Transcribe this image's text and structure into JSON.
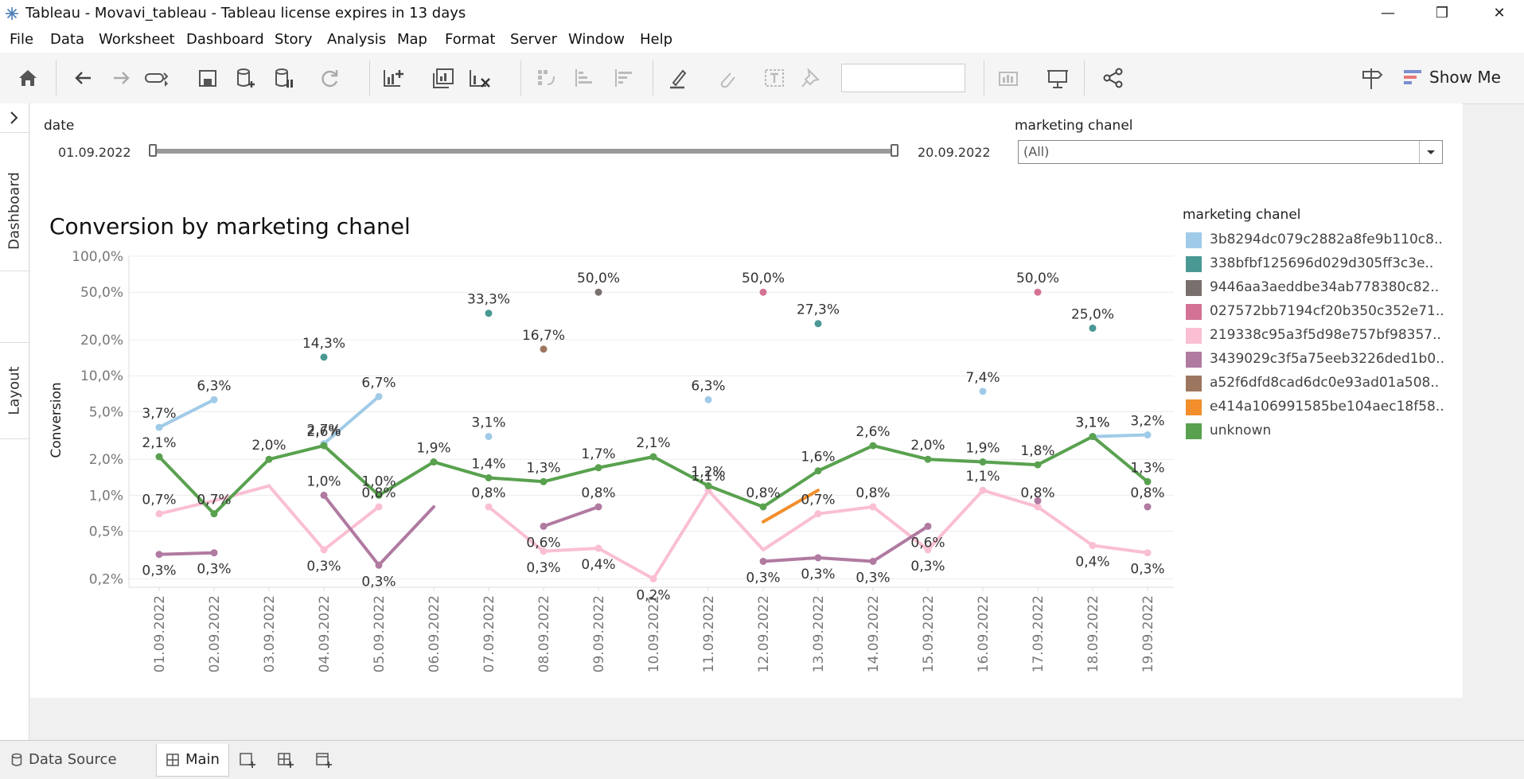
{
  "window": {
    "title": "Tableau - Movavi_tableau - Tableau license expires in 13 days",
    "controls": [
      "—",
      "❒",
      "✕"
    ]
  },
  "menu": [
    "File",
    "Data",
    "Worksheet",
    "Dashboard",
    "Story",
    "Analysis",
    "Map",
    "Format",
    "Server",
    "Window",
    "Help"
  ],
  "toolbar": {
    "show_me_label": "Show Me",
    "icons": [
      "home-icon",
      "back-icon",
      "forward-icon",
      "cycle-icon",
      "save-icon",
      "new-datasource-icon",
      "pause-icon",
      "refresh-icon",
      "new-worksheet-icon",
      "duplicate-icon",
      "clear-icon",
      "swap-icon",
      "sort-asc-icon",
      "sort-desc-icon",
      "highlight-icon",
      "attach-icon",
      "text-icon",
      "pin-icon",
      "fit-icon",
      "presentation-icon",
      "share-icon",
      "signpost-icon"
    ]
  },
  "sidebar": {
    "tabs": [
      "Dashboard",
      "Layout"
    ]
  },
  "filters": {
    "date": {
      "label": "date",
      "start": "01.09.2022",
      "end": "20.09.2022"
    },
    "channel": {
      "label": "marketing chanel",
      "value": "(All)"
    }
  },
  "chart_title": "Conversion by marketing chanel",
  "legend": {
    "title": "marketing chanel",
    "items": [
      {
        "label": "3b8294dc079c2882a8fe9b110c8..",
        "color": "#a0cbe8"
      },
      {
        "label": "338bfbf125696d029d305ff3c3e..",
        "color": "#499894"
      },
      {
        "label": "9446aa3aeddbe34ab778380c82..",
        "color": "#79706e"
      },
      {
        "label": "027572bb7194cf20b350c352e71..",
        "color": "#d37295"
      },
      {
        "label": "219338c95a3f5d98e757bf98357..",
        "color": "#fabfd2"
      },
      {
        "label": "3439029c3f5a75eeb3226ded1b0..",
        "color": "#b07aa1"
      },
      {
        "label": "a52f6dfd8cad6dc0e93ad01a508..",
        "color": "#9d7660"
      },
      {
        "label": "e414a106991585be104aec18f58..",
        "color": "#f28e2b"
      },
      {
        "label": "unknown",
        "color": "#59a14f"
      }
    ]
  },
  "chart_data": {
    "type": "line",
    "title": "Conversion by marketing chanel",
    "ylabel": "Conversion",
    "xlabel": "",
    "yscale": "log",
    "ylim": [
      0.17,
      100
    ],
    "yticks": [
      0.2,
      0.5,
      1,
      2,
      5,
      10,
      20,
      50,
      100
    ],
    "ytick_labels": [
      "0,2%",
      "0,5%",
      "1,0%",
      "2,0%",
      "5,0%",
      "10,0%",
      "20,0%",
      "50,0%",
      "100,0%"
    ],
    "categories": [
      "01.09.2022",
      "02.09.2022",
      "03.09.2022",
      "04.09.2022",
      "05.09.2022",
      "06.09.2022",
      "07.09.2022",
      "08.09.2022",
      "09.09.2022",
      "10.09.2022",
      "11.09.2022",
      "12.09.2022",
      "13.09.2022",
      "14.09.2022",
      "15.09.2022",
      "16.09.2022",
      "17.09.2022",
      "18.09.2022",
      "19.09.2022"
    ],
    "grid": true,
    "series": [
      {
        "name": "3b8294dc079c2882a8fe9b110c8..",
        "color": "#a0cbe8",
        "values": [
          3.7,
          6.3,
          null,
          2.7,
          6.7,
          null,
          3.1,
          null,
          null,
          null,
          6.3,
          null,
          null,
          null,
          null,
          7.4,
          null,
          3.1,
          3.2
        ],
        "labels": [
          "3,7%",
          "6,3%",
          "",
          "2,7%",
          "6,7%",
          "",
          "3,1%",
          "",
          "",
          "",
          "6,3%",
          "",
          "",
          "",
          "",
          "7,4%",
          "",
          "3,1%",
          "3,2%"
        ]
      },
      {
        "name": "338bfbf125696d029d305ff3c3e..",
        "color": "#499894",
        "values": [
          null,
          null,
          null,
          14.3,
          null,
          null,
          33.3,
          null,
          null,
          null,
          null,
          null,
          27.3,
          null,
          null,
          null,
          null,
          25.0,
          null
        ],
        "labels": [
          "",
          "",
          "",
          "14,3%",
          "",
          "",
          "33,3%",
          "",
          "",
          "",
          "",
          "",
          "27,3%",
          "",
          "",
          "",
          "",
          "25,0%",
          ""
        ]
      },
      {
        "name": "9446aa3aeddbe34ab778380c82..",
        "color": "#79706e",
        "values": [
          null,
          null,
          null,
          null,
          null,
          null,
          null,
          null,
          50.0,
          null,
          null,
          null,
          null,
          null,
          null,
          null,
          null,
          null,
          null
        ],
        "labels": [
          "",
          "",
          "",
          "",
          "",
          "",
          "",
          "",
          "50,0%",
          "",
          "",
          "",
          "",
          "",
          "",
          "",
          "",
          "",
          ""
        ]
      },
      {
        "name": "027572bb7194cf20b350c352e71..",
        "color": "#d37295",
        "values": [
          null,
          null,
          null,
          null,
          null,
          null,
          null,
          null,
          null,
          null,
          null,
          50.0,
          null,
          null,
          null,
          null,
          50.0,
          null,
          null
        ],
        "labels": [
          "",
          "",
          "",
          "",
          "",
          "",
          "",
          "",
          "",
          "",
          "",
          "50,0%",
          "",
          "",
          "",
          "",
          "50,0%",
          "",
          ""
        ]
      },
      {
        "name": "219338c95a3f5d98e757bf98357..",
        "color": "#fabfd2",
        "values": [
          0.7,
          0.9,
          1.2,
          0.35,
          0.8,
          null,
          0.8,
          0.34,
          0.36,
          0.2,
          1.1,
          0.35,
          0.7,
          0.8,
          0.35,
          1.1,
          0.8,
          0.38,
          0.33
        ],
        "labels": [
          "0,7%",
          "",
          "",
          "0,3%",
          "0,8%",
          "",
          "0,8%",
          "0,3%",
          "0,4%",
          "0,2%",
          "1,1%",
          "",
          "0,7%",
          "0,8%",
          "0,3%",
          "1,1%",
          "0,8%",
          "0,4%",
          "0,3%"
        ]
      },
      {
        "name": "3439029c3f5a75eeb3226ded1b0..",
        "color": "#b07aa1",
        "values": [
          0.32,
          0.33,
          null,
          1.0,
          0.26,
          0.8,
          null,
          0.55,
          0.8,
          null,
          null,
          0.28,
          0.3,
          0.28,
          0.55,
          null,
          0.9,
          null,
          0.8
        ],
        "labels": [
          "0,3%",
          "0,3%",
          "",
          "1,0%",
          "0,3%",
          "",
          "",
          "0,6%",
          "0,8%",
          "",
          "",
          "0,3%",
          "0,3%",
          "0,3%",
          "0,6%",
          "",
          "",
          "",
          "0,8%"
        ]
      },
      {
        "name": "a52f6dfd8cad6dc0e93ad01a508..",
        "color": "#9d7660",
        "values": [
          null,
          null,
          null,
          null,
          null,
          null,
          null,
          16.7,
          null,
          null,
          null,
          null,
          null,
          null,
          null,
          null,
          null,
          null,
          null
        ],
        "labels": [
          "",
          "",
          "",
          "",
          "",
          "",
          "",
          "16,7%",
          "",
          "",
          "",
          "",
          "",
          "",
          "",
          "",
          "",
          "",
          ""
        ]
      },
      {
        "name": "e414a106991585be104aec18f58..",
        "color": "#f28e2b",
        "values": [
          null,
          null,
          null,
          null,
          null,
          null,
          null,
          null,
          null,
          null,
          null,
          0.6,
          1.1,
          null,
          null,
          null,
          null,
          null,
          null
        ],
        "labels": [
          "",
          "",
          "",
          "",
          "",
          "",
          "",
          "",
          "",
          "",
          "",
          "",
          "",
          "",
          "",
          "",
          "",
          "",
          ""
        ]
      },
      {
        "name": "unknown",
        "color": "#59a14f",
        "values": [
          2.1,
          0.7,
          2.0,
          2.6,
          1.0,
          1.9,
          1.4,
          1.3,
          1.7,
          2.1,
          1.2,
          0.8,
          1.6,
          2.6,
          2.0,
          1.9,
          1.8,
          3.1,
          1.3
        ],
        "labels": [
          "2,1%",
          "0,7%",
          "2,0%",
          "2,6%",
          "1,0%",
          "1,9%",
          "1,4%",
          "1,3%",
          "1,7%",
          "2,1%",
          "1,2%",
          "0,8%",
          "1,6%",
          "2,6%",
          "2,0%",
          "1,9%",
          "1,8%",
          "3,1%",
          "1,3%"
        ]
      }
    ],
    "legend_position": "right"
  },
  "bottom_tabs": {
    "data_source": "Data Source",
    "sheet": "Main"
  }
}
